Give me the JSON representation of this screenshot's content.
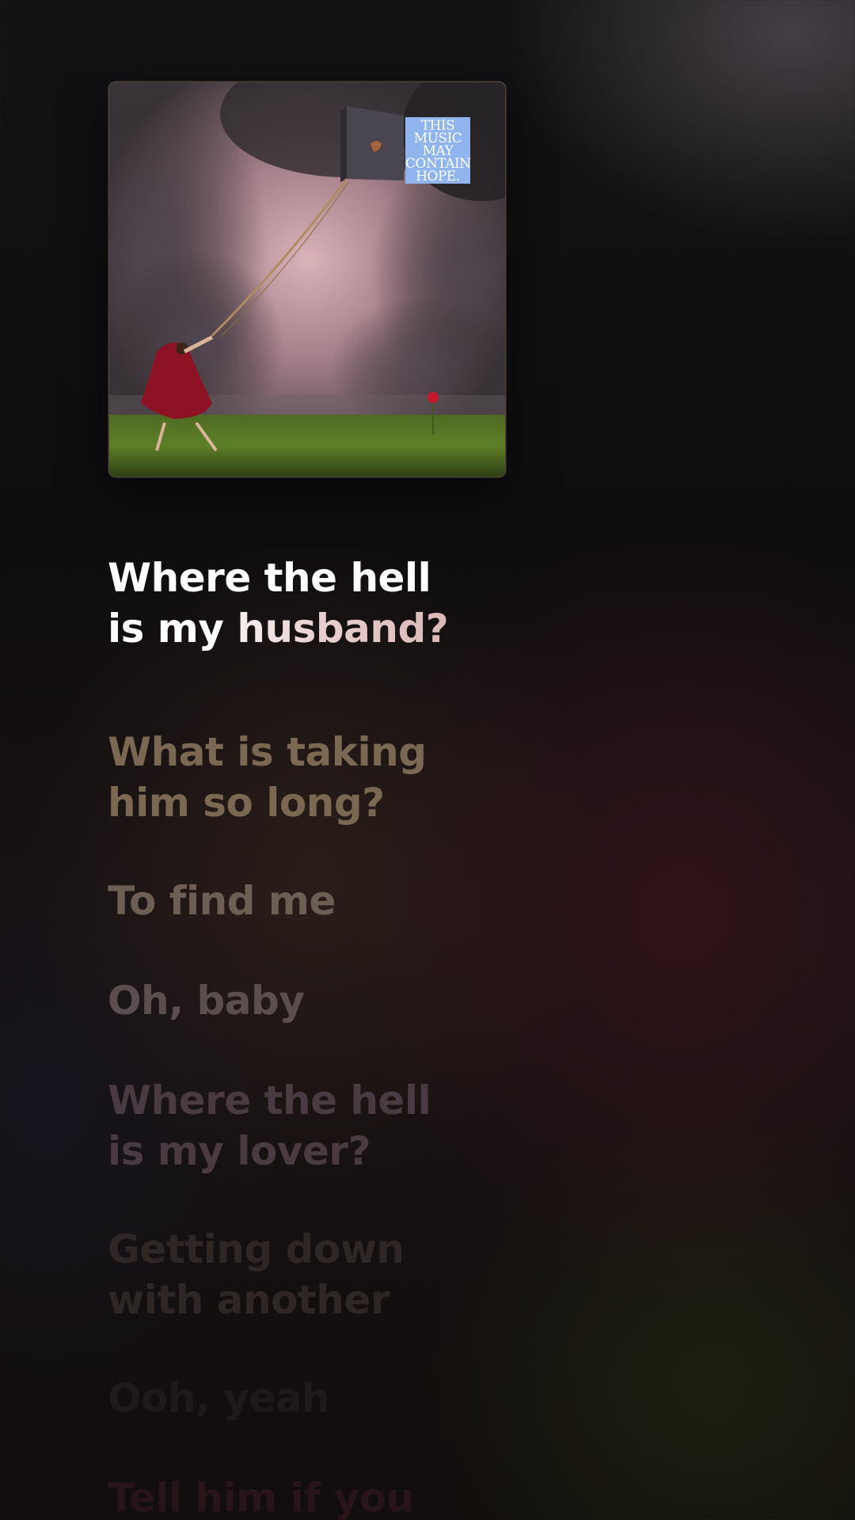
{
  "album": {
    "cover_text": [
      "THIS",
      "MUSIC",
      "MAY",
      "CONTAIN",
      "HOPE."
    ]
  },
  "lyrics": {
    "active": {
      "line1": "Where the hell",
      "line2_sung": "is my ",
      "line2_unsung": "husband?"
    },
    "upcoming": [
      {
        "lines": [
          "What is taking",
          "him so long?"
        ]
      },
      {
        "lines": [
          "To find me"
        ]
      },
      {
        "lines": [
          "Oh, baby"
        ]
      },
      {
        "lines": [
          "Where the hell",
          "is my lover?"
        ]
      },
      {
        "lines": [
          "Getting down",
          "with another"
        ]
      },
      {
        "lines": [
          "Ooh, yeah"
        ]
      },
      {
        "lines": [
          "Tell him if you"
        ]
      }
    ]
  },
  "colors": {
    "active_lyric": "#ffffff",
    "album_sign": "#8fb4ee"
  }
}
